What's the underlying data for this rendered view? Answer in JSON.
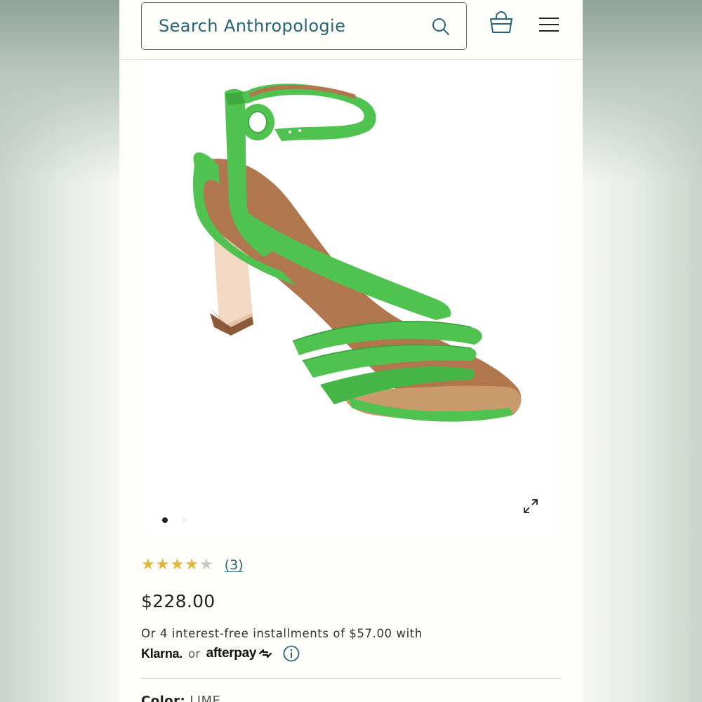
{
  "search": {
    "placeholder": "Search Anthropologie"
  },
  "header": {
    "search_icon": "search-icon",
    "bag_icon": "shopping-bag-icon",
    "menu_icon": "hamburger-menu-icon"
  },
  "gallery": {
    "image": "green-strappy-heeled-sandal",
    "current_slide": 1,
    "total_slides": 2,
    "expand_icon": "expand-icon"
  },
  "product": {
    "rating": 4,
    "rating_max": 5,
    "review_count_label": "(3)",
    "price": "$228.00",
    "installments_text": "Or 4 interest-free installments of $57.00 with",
    "klarna_label": "Klarna.",
    "or_label": "or",
    "afterpay_label": "afterpay",
    "color_label": "Color:",
    "color_value": "LIME"
  },
  "colors": {
    "accent_teal": "#2b6474",
    "star_gold": "#e3b33c",
    "sandal_green": "#4fc24f"
  }
}
